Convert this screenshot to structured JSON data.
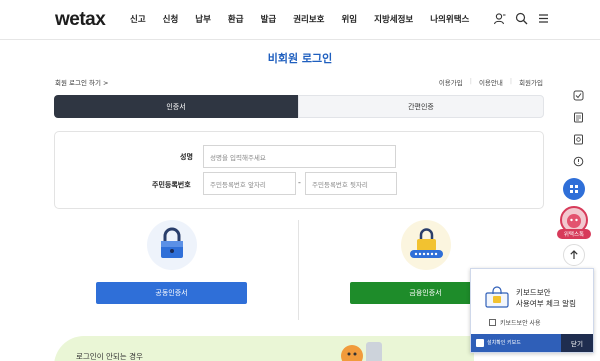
{
  "header": {
    "logo": "wetax",
    "nav": [
      "신고",
      "신청",
      "납부",
      "환급",
      "발급",
      "권리보호",
      "위임",
      "지방세정보",
      "나의위택스"
    ],
    "icons": [
      "user-icon",
      "search-icon",
      "menu-icon"
    ]
  },
  "page_title": "비회원 로그인",
  "find_link": "회원 로그인 하기 >",
  "top_links": [
    "이용가입",
    "이용안내",
    "회원가입"
  ],
  "tabs": {
    "active": "인증서",
    "inactive": "간편인증"
  },
  "form": {
    "name_label": "성명",
    "name_placeholder": "성명을 입력해주세요",
    "rrn_label": "주민등록번호",
    "rrn_first_placeholder": "주민등록번호 앞자리",
    "rrn_dash": "-",
    "rrn_second_placeholder": "주민등록번호 뒷자리"
  },
  "certs": {
    "public_button": "공동인증서",
    "financial_button": "금융인증서"
  },
  "banner": {
    "text": "로그인이 안되는 경우"
  },
  "quick_menu": {
    "icons": [
      "shortcut-1-icon",
      "shortcut-2-icon",
      "shortcut-3-icon",
      "shortcut-4-icon"
    ],
    "badge_label": "위택스톡"
  },
  "keyboard_popup": {
    "title_line1": "키보드보안",
    "title_line2": "사용여부 체크 알림",
    "checkbox_label": "키보드보안 사용",
    "bar_label": "설치확인 키보드",
    "close": "닫기"
  },
  "colors": {
    "brand_blue": "#1f5fbf",
    "button_blue": "#2f6fd8",
    "button_green": "#1e8c2a",
    "tab_dark": "#2f3642"
  }
}
